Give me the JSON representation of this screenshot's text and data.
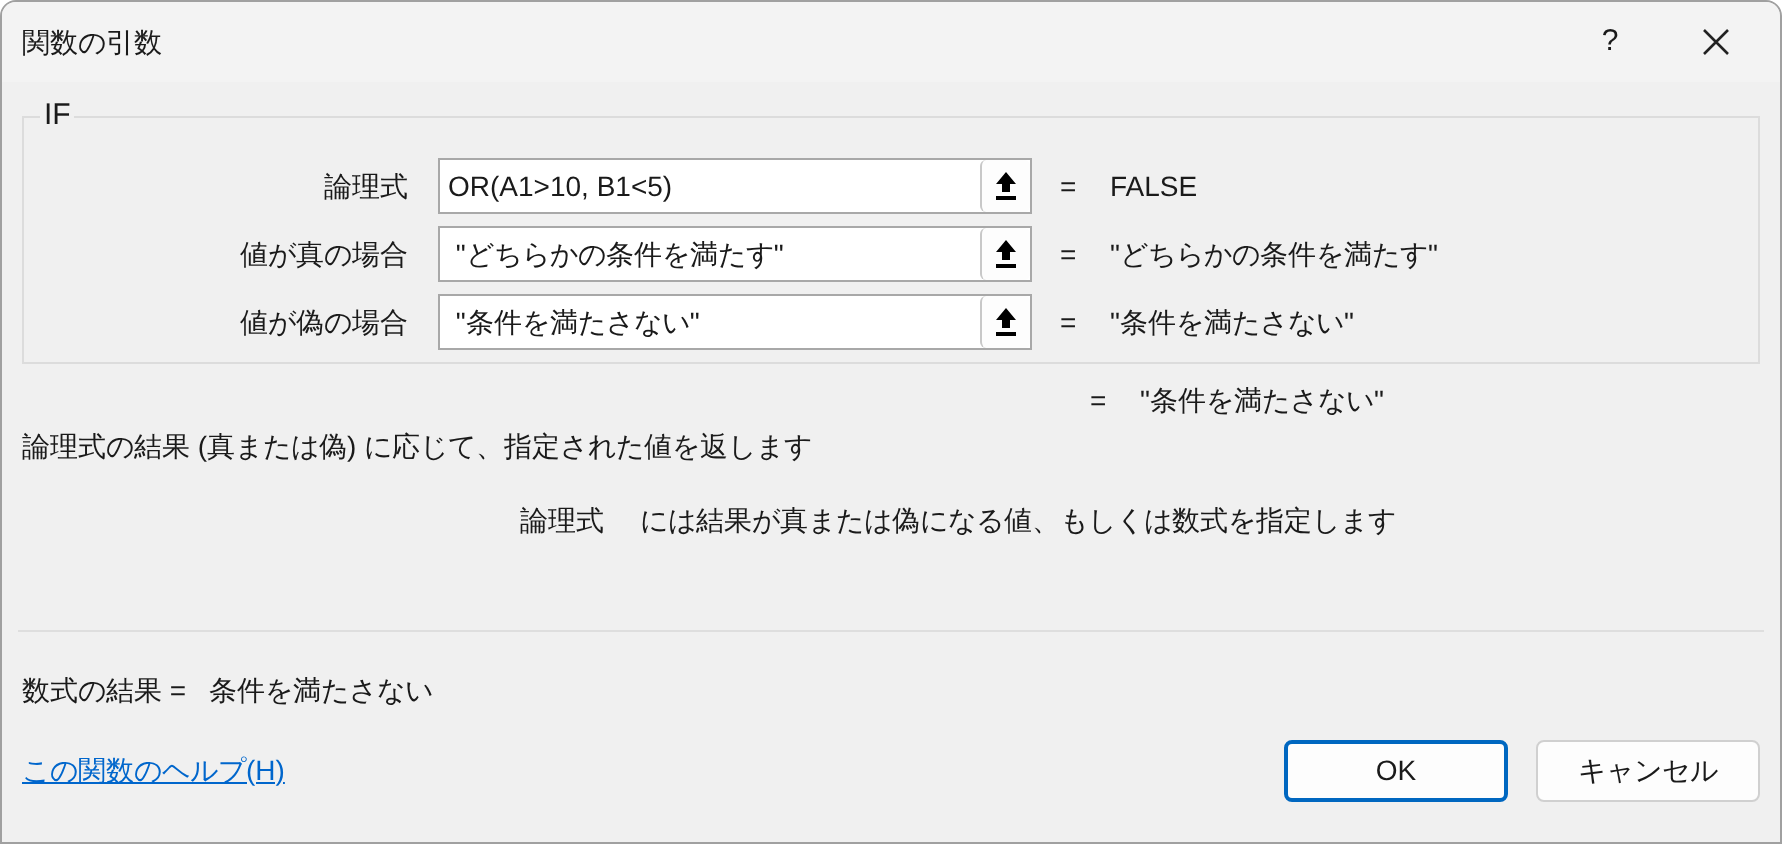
{
  "window": {
    "title": "関数の引数",
    "help": "?"
  },
  "group": {
    "title": "IF",
    "args": [
      {
        "label": "論理式",
        "value": "OR(A1>10, B1<5)",
        "equals": "=",
        "result": "FALSE"
      },
      {
        "label": "値が真の場合",
        "value": " \"どちらかの条件を満たす\"",
        "equals": "=",
        "result": "\"どちらかの条件を満たす\""
      },
      {
        "label": "値が偽の場合",
        "value": " \"条件を満たさない\"",
        "equals": "=",
        "result": "\"条件を満たさない\""
      }
    ]
  },
  "overall": {
    "equals": "=",
    "result": "\"条件を満たさない\""
  },
  "description": "論理式の結果 (真または偽) に応じて、指定された値を返します",
  "arg_help": {
    "name": "論理式",
    "text": "には結果が真または偽になる値、もしくは数式を指定します"
  },
  "formula_result": {
    "label": "数式の結果 =",
    "value": "条件を満たさない"
  },
  "help_link": "この関数のヘルプ(H)",
  "buttons": [
    {
      "label": "OK",
      "focused": true
    },
    {
      "label": "キャンセル",
      "focused": false
    }
  ]
}
